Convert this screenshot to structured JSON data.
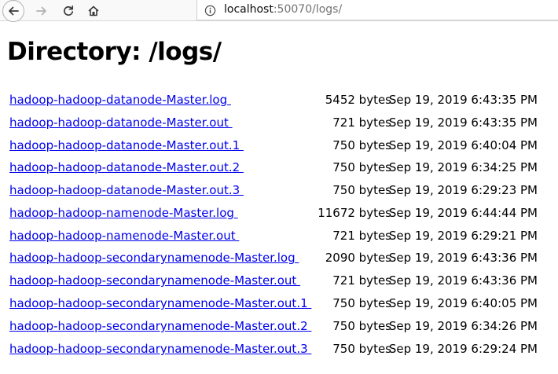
{
  "browser": {
    "back_icon": "arrow-left-icon",
    "forward_icon": "arrow-right-icon",
    "reload_icon": "reload-icon",
    "home_icon": "home-icon",
    "info_icon": "info-icon",
    "url_host": "localhost",
    "url_rest": ":50070/logs/"
  },
  "page": {
    "title": "Directory: /logs/"
  },
  "files": [
    {
      "name": "hadoop-hadoop-datanode-Master.log ",
      "size": "5452 bytes",
      "date": "Sep 19, 2019 6:43:35 PM"
    },
    {
      "name": "hadoop-hadoop-datanode-Master.out ",
      "size": "721 bytes",
      "date": "Sep 19, 2019 6:43:35 PM"
    },
    {
      "name": "hadoop-hadoop-datanode-Master.out.1 ",
      "size": "750 bytes",
      "date": "Sep 19, 2019 6:40:04 PM"
    },
    {
      "name": "hadoop-hadoop-datanode-Master.out.2 ",
      "size": "750 bytes",
      "date": "Sep 19, 2019 6:34:25 PM"
    },
    {
      "name": "hadoop-hadoop-datanode-Master.out.3 ",
      "size": "750 bytes",
      "date": "Sep 19, 2019 6:29:23 PM"
    },
    {
      "name": "hadoop-hadoop-namenode-Master.log ",
      "size": "11672 bytes",
      "date": "Sep 19, 2019 6:44:44 PM"
    },
    {
      "name": "hadoop-hadoop-namenode-Master.out ",
      "size": "721 bytes",
      "date": "Sep 19, 2019 6:29:21 PM"
    },
    {
      "name": "hadoop-hadoop-secondarynamenode-Master.log ",
      "size": "2090 bytes",
      "date": "Sep 19, 2019 6:43:36 PM"
    },
    {
      "name": "hadoop-hadoop-secondarynamenode-Master.out ",
      "size": "721 bytes",
      "date": "Sep 19, 2019 6:43:36 PM"
    },
    {
      "name": "hadoop-hadoop-secondarynamenode-Master.out.1 ",
      "size": "750 bytes",
      "date": "Sep 19, 2019 6:40:05 PM"
    },
    {
      "name": "hadoop-hadoop-secondarynamenode-Master.out.2 ",
      "size": "750 bytes",
      "date": "Sep 19, 2019 6:34:26 PM"
    },
    {
      "name": "hadoop-hadoop-secondarynamenode-Master.out.3 ",
      "size": "750 bytes",
      "date": "Sep 19, 2019 6:29:24 PM"
    }
  ]
}
